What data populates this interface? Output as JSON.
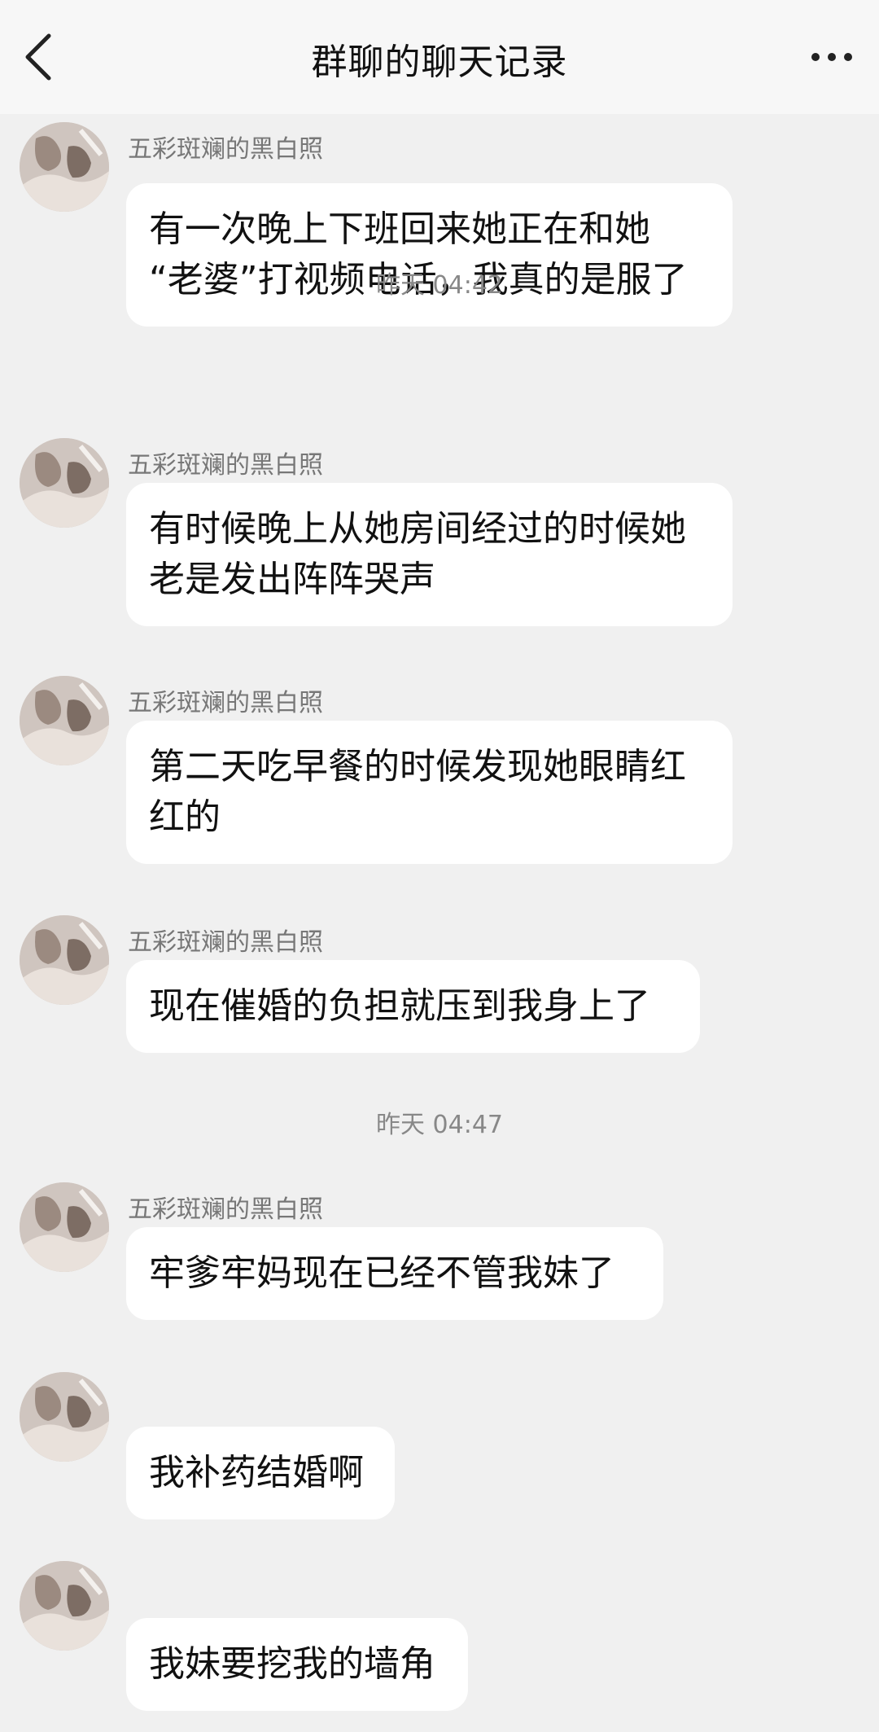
{
  "header": {
    "title": "群聊的聊天记录",
    "back_icon": "chevron-left-icon",
    "more_icon": "more-dots-icon"
  },
  "timestamps": [
    "昨天 04:42",
    "昨天 04:47"
  ],
  "messages": [
    {
      "sender": "五彩斑斓的黑白照",
      "text": "有一次晚上下班回来她正在和她\n“老婆”打视频电话，我真的是服了"
    },
    {
      "sender": "五彩斑斓的黑白照",
      "text": "有时候晚上从她房间经过的时候她\n老是发出阵阵哭声"
    },
    {
      "sender": "五彩斑斓的黑白照",
      "text": "第二天吃早餐的时候发现她眼睛红\n红的"
    },
    {
      "sender": "五彩斑斓的黑白照",
      "text": "现在催婚的负担就压到我身上了"
    },
    {
      "sender": "五彩斑斓的黑白照",
      "text": "牢爹牢妈现在已经不管我妹了"
    },
    {
      "sender": "",
      "text": "我补药结婚啊"
    },
    {
      "sender": "",
      "text": "我妹要挖我的墙角"
    }
  ]
}
